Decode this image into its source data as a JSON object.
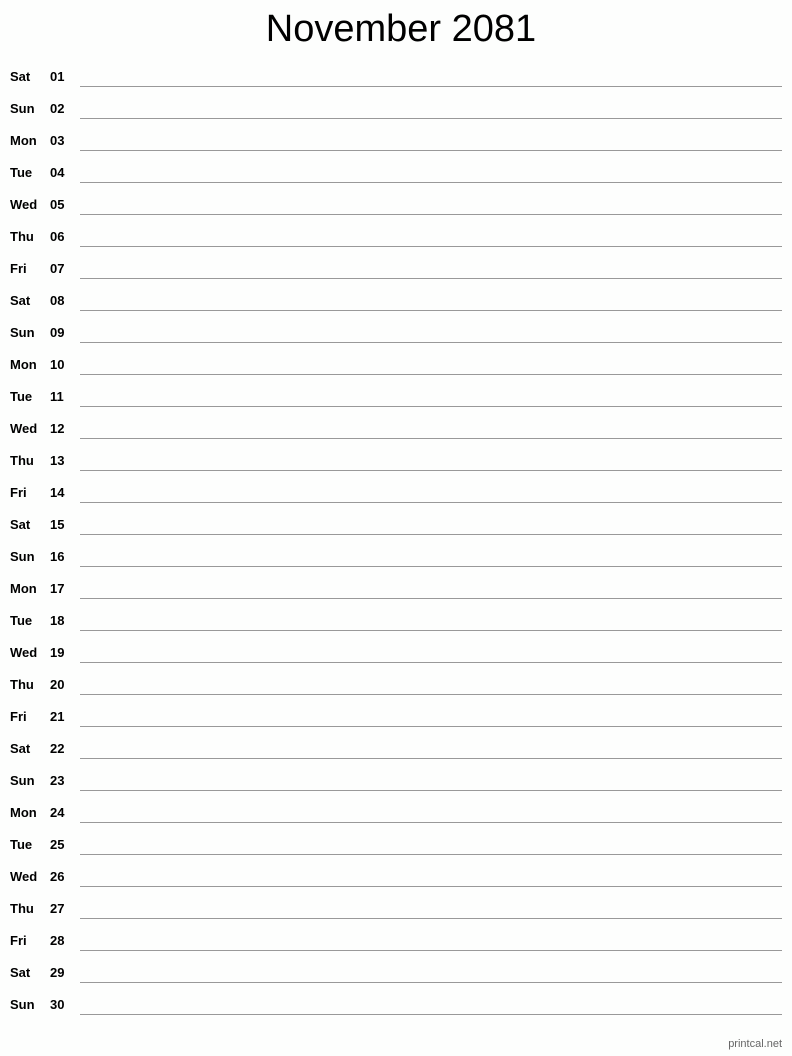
{
  "title": "November 2081",
  "days": [
    {
      "dow": "Sat",
      "num": "01"
    },
    {
      "dow": "Sun",
      "num": "02"
    },
    {
      "dow": "Mon",
      "num": "03"
    },
    {
      "dow": "Tue",
      "num": "04"
    },
    {
      "dow": "Wed",
      "num": "05"
    },
    {
      "dow": "Thu",
      "num": "06"
    },
    {
      "dow": "Fri",
      "num": "07"
    },
    {
      "dow": "Sat",
      "num": "08"
    },
    {
      "dow": "Sun",
      "num": "09"
    },
    {
      "dow": "Mon",
      "num": "10"
    },
    {
      "dow": "Tue",
      "num": "11"
    },
    {
      "dow": "Wed",
      "num": "12"
    },
    {
      "dow": "Thu",
      "num": "13"
    },
    {
      "dow": "Fri",
      "num": "14"
    },
    {
      "dow": "Sat",
      "num": "15"
    },
    {
      "dow": "Sun",
      "num": "16"
    },
    {
      "dow": "Mon",
      "num": "17"
    },
    {
      "dow": "Tue",
      "num": "18"
    },
    {
      "dow": "Wed",
      "num": "19"
    },
    {
      "dow": "Thu",
      "num": "20"
    },
    {
      "dow": "Fri",
      "num": "21"
    },
    {
      "dow": "Sat",
      "num": "22"
    },
    {
      "dow": "Sun",
      "num": "23"
    },
    {
      "dow": "Mon",
      "num": "24"
    },
    {
      "dow": "Tue",
      "num": "25"
    },
    {
      "dow": "Wed",
      "num": "26"
    },
    {
      "dow": "Thu",
      "num": "27"
    },
    {
      "dow": "Fri",
      "num": "28"
    },
    {
      "dow": "Sat",
      "num": "29"
    },
    {
      "dow": "Sun",
      "num": "30"
    }
  ],
  "footer": "printcal.net"
}
